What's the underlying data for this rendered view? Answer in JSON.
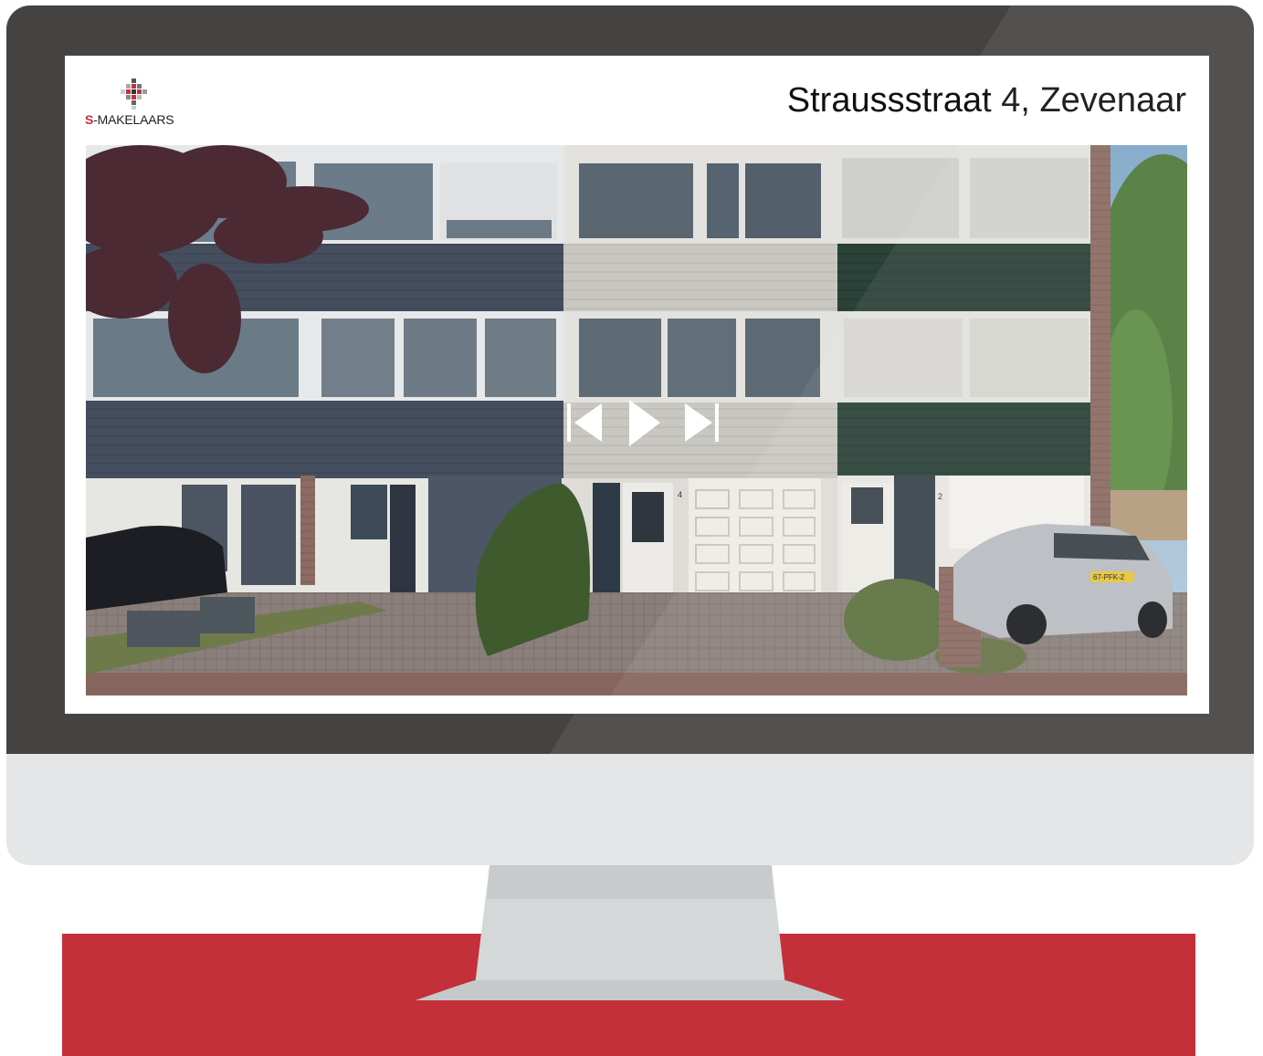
{
  "window": {
    "logo": {
      "prefix": "S",
      "suffix": "-MAKELAARS"
    },
    "address": "Straussstraat 4, Zevenaar"
  },
  "player": {
    "controls": [
      "skip-back-icon",
      "play-icon",
      "skip-forward-icon"
    ]
  },
  "photo": {
    "house_numbers": [
      "4",
      "2"
    ],
    "license_plate": "67-PFK-2"
  },
  "colors": {
    "brand_red": "#c4303a",
    "bezel": "#444341",
    "chin": "#e5e6e8",
    "stand": "#d5d8d9"
  }
}
